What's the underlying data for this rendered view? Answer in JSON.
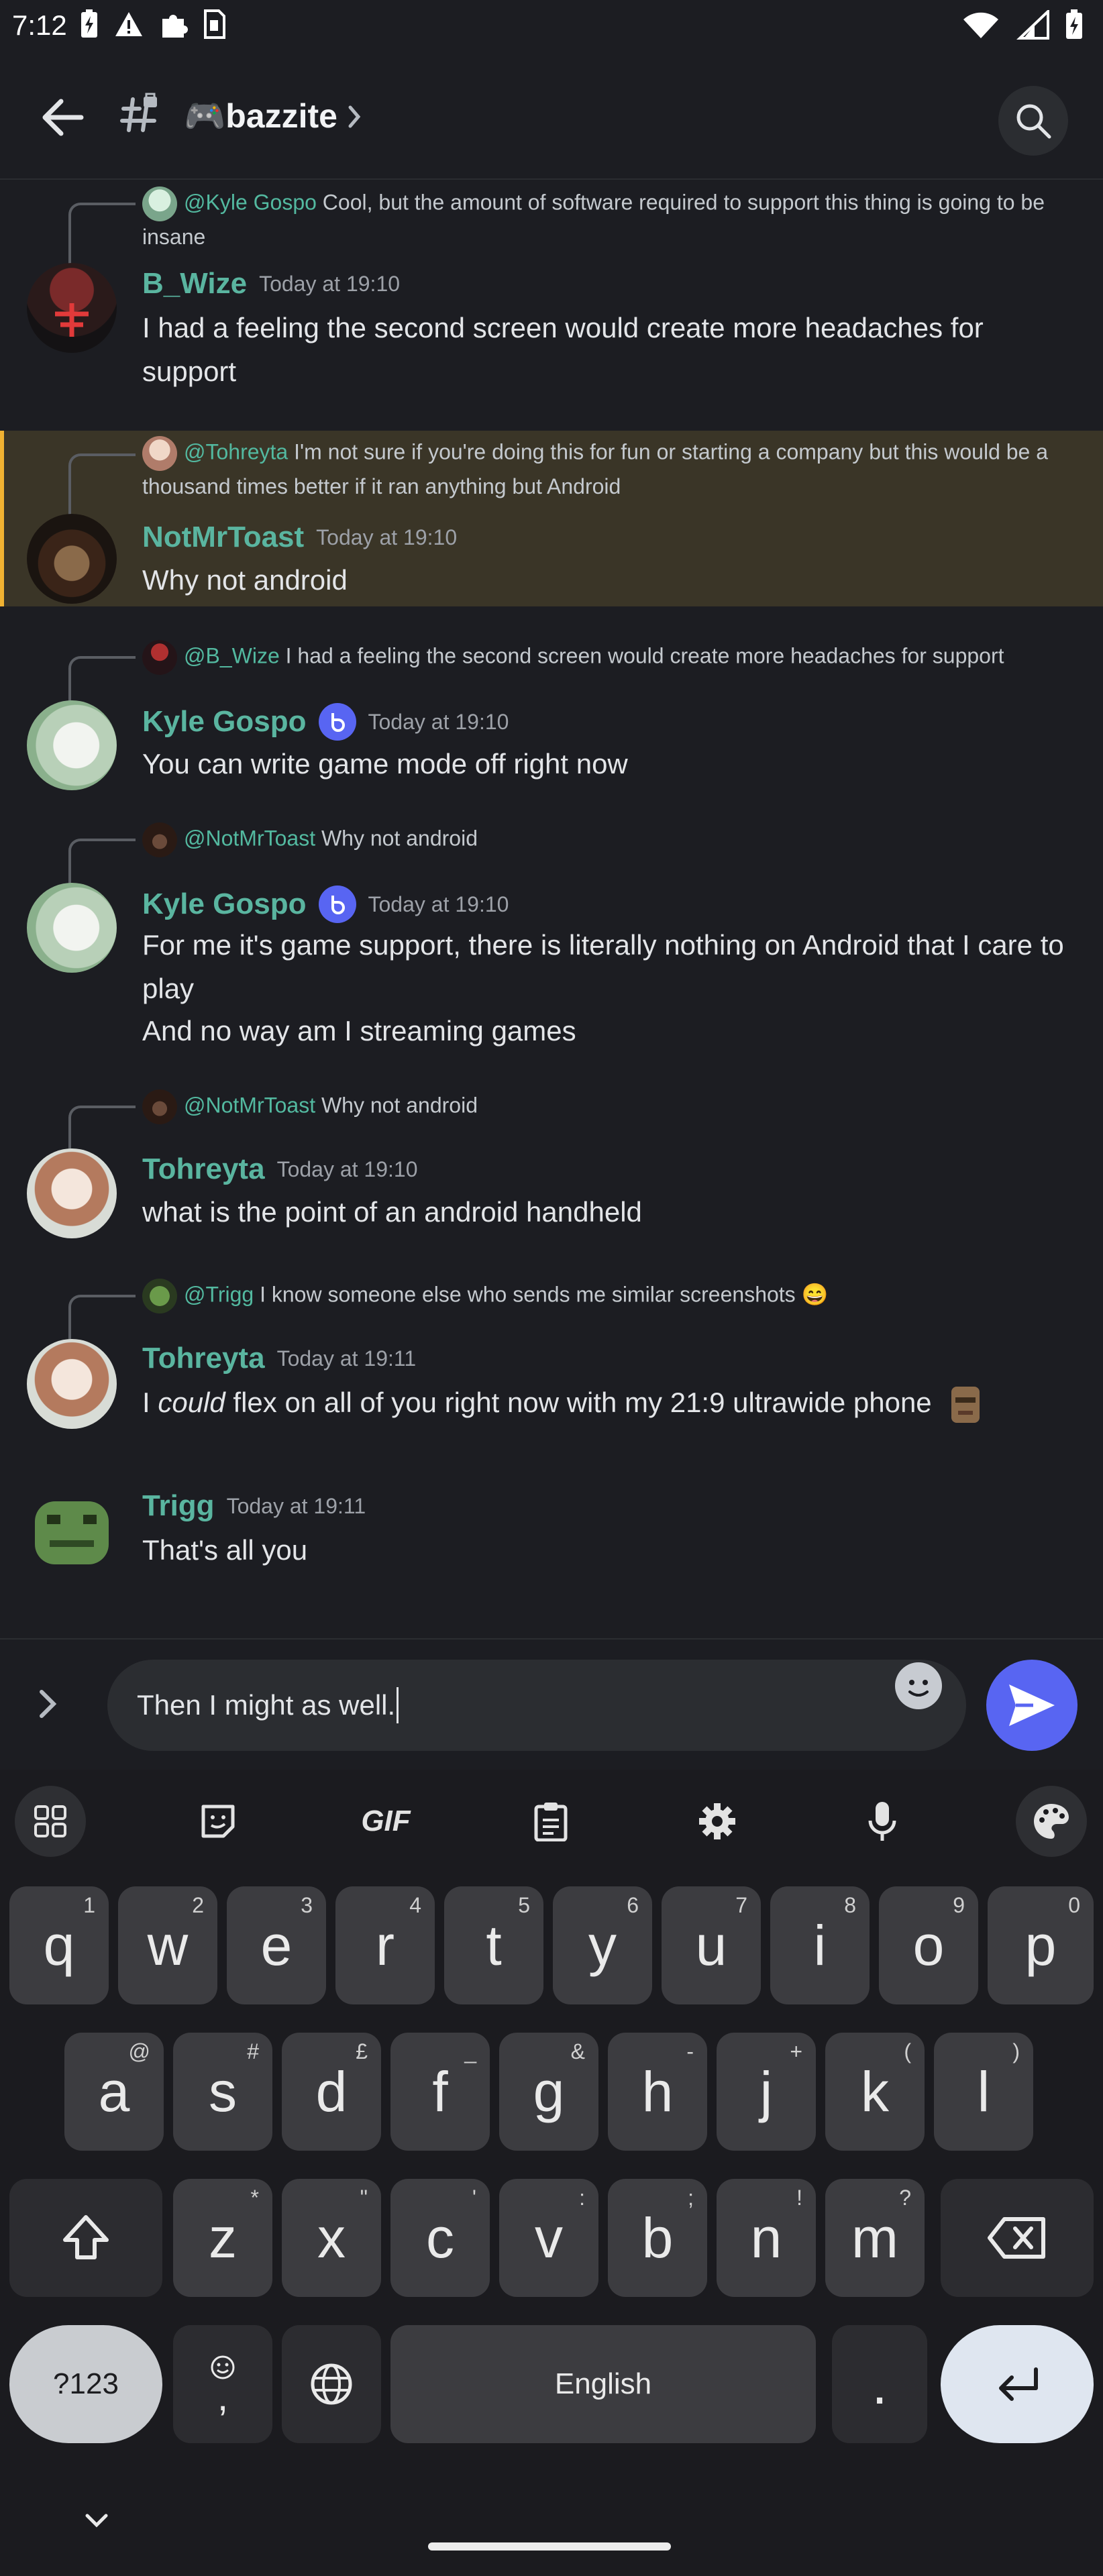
{
  "status_bar": {
    "time": "7:12"
  },
  "header": {
    "channel_name": "🎮bazzite"
  },
  "messages": [
    {
      "reply_to": {
        "name": "@Kyle Gospo",
        "text": "Cool, but the amount of software required to support this thing is going to be insane"
      },
      "author": "B_Wize",
      "timestamp": "Today at 19:10",
      "lines": [
        "I had a feeling the second screen would create more headaches for support"
      ]
    },
    {
      "reply_to": {
        "name": "@Tohreyta",
        "text": "I'm not sure if you're doing this for fun or starting a company but this would be a thousand times better if it ran anything but Android"
      },
      "author": "NotMrToast",
      "timestamp": "Today at 19:10",
      "lines": [
        "Why not android"
      ],
      "highlighted": true
    },
    {
      "reply_to": {
        "name": "@B_Wize",
        "text": "I had a feeling the second screen would create more headaches for support"
      },
      "author": "Kyle Gospo",
      "timestamp": "Today at 19:10",
      "lines": [
        "You can write game mode off right now"
      ]
    },
    {
      "reply_to": {
        "name": "@NotMrToast",
        "text": "Why not android"
      },
      "author": "Kyle Gospo",
      "timestamp": "Today at 19:10",
      "lines": [
        "For me it's game support, there is literally nothing on Android that I care to play",
        "And no way am I streaming games"
      ]
    },
    {
      "reply_to": {
        "name": "@NotMrToast",
        "text": "Why not android"
      },
      "author": "Tohreyta",
      "timestamp": "Today at 19:10",
      "lines": [
        "what is the point of an android handheld"
      ]
    },
    {
      "reply_to": {
        "name": "@Trigg",
        "text": "I know someone else who sends me similar screenshots 😄"
      },
      "author": "Tohreyta",
      "timestamp": "Today at 19:11",
      "line_parts": {
        "pre": "I ",
        "em": "could",
        "post": " flex on all of you right now with my 21:9 ultrawide phone"
      }
    },
    {
      "author": "Trigg",
      "timestamp": "Today at 19:11",
      "lines": [
        "That's all you"
      ]
    }
  ],
  "composer": {
    "value": "Then I might as well."
  },
  "keyboard": {
    "toolbar": [
      "apps-grid-icon",
      "sticker-icon",
      "GIF",
      "clipboard-icon",
      "settings-icon",
      "mic-icon",
      "palette-icon"
    ],
    "row1": [
      [
        "q",
        "1"
      ],
      [
        "w",
        "2"
      ],
      [
        "e",
        "3"
      ],
      [
        "r",
        "4"
      ],
      [
        "t",
        "5"
      ],
      [
        "y",
        "6"
      ],
      [
        "u",
        "7"
      ],
      [
        "i",
        "8"
      ],
      [
        "o",
        "9"
      ],
      [
        "p",
        "0"
      ]
    ],
    "row2": [
      [
        "a",
        "@"
      ],
      [
        "s",
        "#"
      ],
      [
        "d",
        "£"
      ],
      [
        "f",
        "_"
      ],
      [
        "g",
        "&"
      ],
      [
        "h",
        "-"
      ],
      [
        "j",
        "+"
      ],
      [
        "k",
        "("
      ],
      [
        "l",
        ")"
      ]
    ],
    "row3": [
      [
        "z",
        "*"
      ],
      [
        "x",
        "\""
      ],
      [
        "c",
        "'"
      ],
      [
        "v",
        ":"
      ],
      [
        "b",
        ";"
      ],
      [
        "n",
        "!"
      ],
      [
        "m",
        "?"
      ]
    ],
    "symbols_label": "?123",
    "comma_label": ",",
    "space_label": "English",
    "period_label": "."
  },
  "colors": {
    "accent": "#5865f2",
    "author": "#5ab5a0",
    "highlight_bar": "#f0b232"
  }
}
